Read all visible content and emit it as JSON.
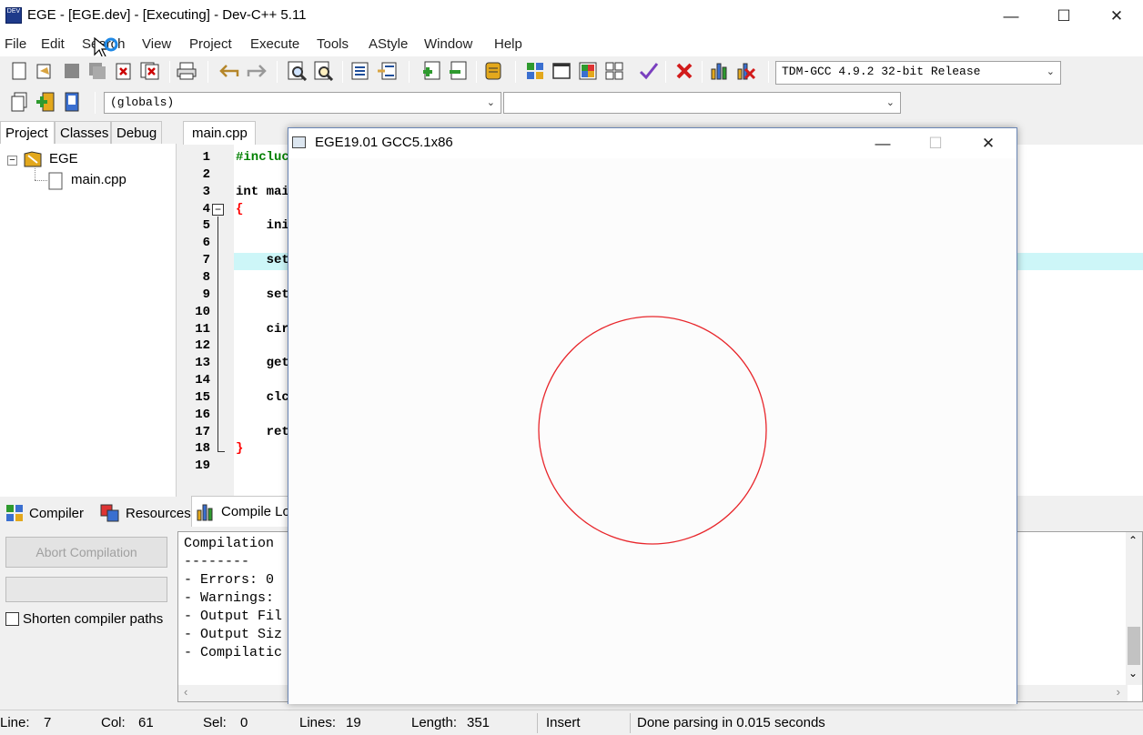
{
  "window": {
    "title": "EGE - [EGE.dev] - [Executing] - Dev-C++ 5.11",
    "icon_text": "DEV"
  },
  "menu": [
    "File",
    "Edit",
    "Search",
    "View",
    "Project",
    "Execute",
    "Tools",
    "AStyle",
    "Window",
    "Help"
  ],
  "toolbar": {
    "compiler_select": "TDM-GCC 4.9.2 32-bit Release",
    "scope_select": "(globals)",
    "symbol_select": ""
  },
  "left_panel": {
    "tabs": [
      "Project",
      "Classes",
      "Debug"
    ],
    "tree_root": "EGE",
    "tree_file": "main.cpp"
  },
  "editor": {
    "tab_label": "main.cpp",
    "line_numbers": [
      "1",
      "2",
      "3",
      "4",
      "5",
      "6",
      "7",
      "8",
      "9",
      "10",
      "11",
      "12",
      "13",
      "14",
      "15",
      "16",
      "17",
      "18",
      "19"
    ],
    "lines": [
      "#incluc",
      "",
      "int mai",
      "{",
      "    ini",
      "",
      "    set",
      "",
      "    set",
      "",
      "    cir",
      "",
      "    get",
      "",
      "    clc",
      "",
      "    ret",
      "}",
      ""
    ]
  },
  "bottom_panel": {
    "tabs": [
      "Compiler",
      "Resources",
      "Compile Lo"
    ],
    "abort_button": "Abort Compilation",
    "shorten_label": "Shorten compiler paths",
    "log_lines": [
      "Compilation",
      "--------",
      "- Errors: 0",
      "- Warnings:",
      "- Output Fil",
      "- Output Siz",
      "- Compilatic"
    ]
  },
  "statusbar": {
    "line_label": "Line:",
    "line_value": "7",
    "col_label": "Col:",
    "col_value": "61",
    "sel_label": "Sel:",
    "sel_value": "0",
    "lines_label": "Lines:",
    "lines_value": "19",
    "length_label": "Length:",
    "length_value": "351",
    "mode": "Insert",
    "message": "Done parsing in 0.015 seconds"
  },
  "ege_window": {
    "title": "EGE19.01 GCC5.1x86",
    "circle_color": "#e8262b"
  },
  "colors": {
    "keyword": "#000000",
    "preprocessor": "#008000",
    "brace": "#ff0000",
    "current_line": "#cdf6f8"
  }
}
